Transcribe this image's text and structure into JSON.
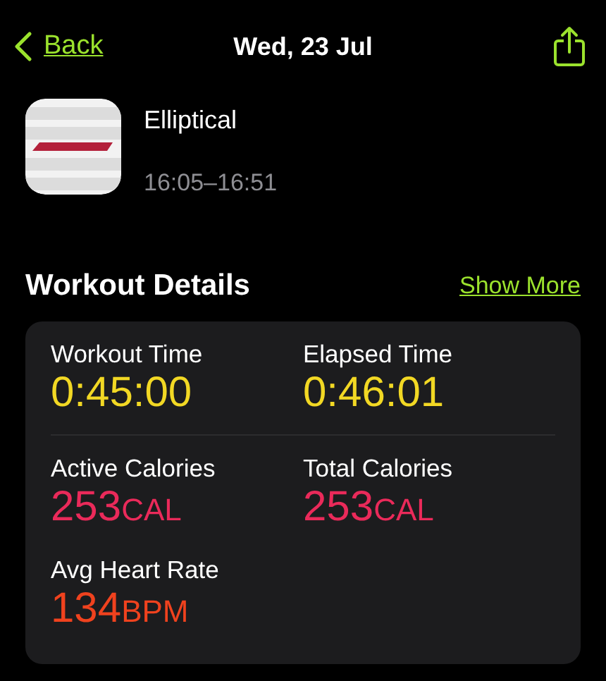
{
  "nav": {
    "back": "Back",
    "title": "Wed, 23 Jul"
  },
  "workout": {
    "name": "Elliptical",
    "time_range": "16:05–16:51"
  },
  "section": {
    "title": "Workout Details",
    "action": "Show More"
  },
  "metrics": [
    {
      "label": "Workout Time",
      "value": "0:45:00",
      "color": "#f2d824"
    },
    {
      "label": "Elapsed Time",
      "value": "0:46:01",
      "color": "#f2d824"
    },
    {
      "label": "Active Calories",
      "value": "253",
      "unit": "CAL",
      "color": "#ea2a5a"
    },
    {
      "label": "Total Calories",
      "value": "253",
      "unit": "CAL",
      "color": "#ea2a5a"
    },
    {
      "label": "Avg Heart Rate",
      "value": "134",
      "unit": "BPM",
      "color": "#f0421e"
    }
  ]
}
